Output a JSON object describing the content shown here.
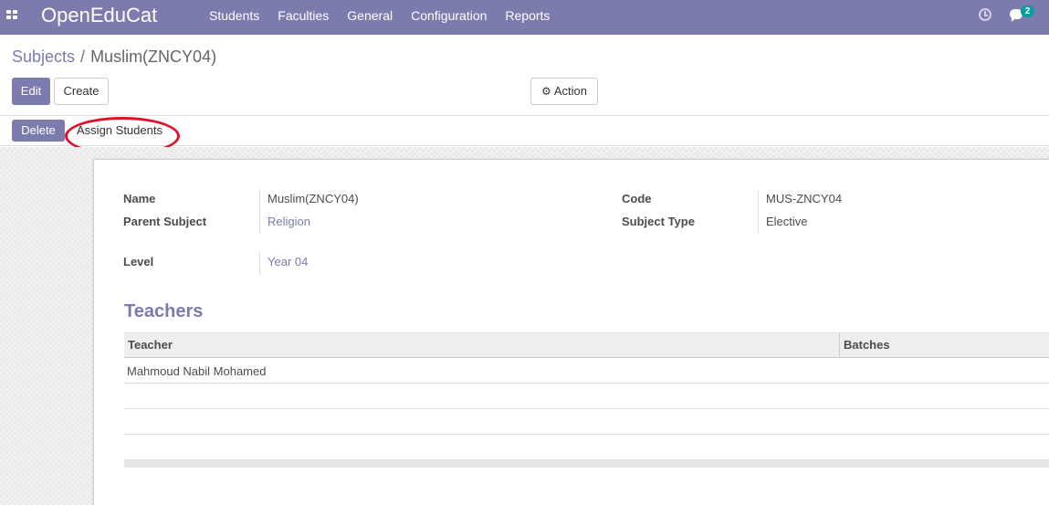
{
  "navbar": {
    "brand": "OpenEduCat",
    "menu": [
      "Students",
      "Faculties",
      "General",
      "Configuration",
      "Reports"
    ],
    "messages_count": "2"
  },
  "control_panel": {
    "breadcrumb": {
      "parent": "Subjects",
      "separator": "/",
      "current": "Muslim(ZNCY04)"
    },
    "edit_label": "Edit",
    "create_label": "Create",
    "action_label": "Action",
    "delete_label": "Delete",
    "assign_students_label": "Assign Students"
  },
  "form": {
    "name_label": "Name",
    "name_value": "Muslim(ZNCY04)",
    "parent_subject_label": "Parent Subject",
    "parent_subject_value": "Religion",
    "level_label": "Level",
    "level_value": "Year 04",
    "code_label": "Code",
    "code_value": "MUS-ZNCY04",
    "subject_type_label": "Subject Type",
    "subject_type_value": "Elective"
  },
  "teachers": {
    "title": "Teachers",
    "columns": [
      "Teacher",
      "Batches"
    ],
    "rows": [
      {
        "teacher": "Mahmoud Nabil Mohamed",
        "batches": ""
      }
    ]
  },
  "colors": {
    "brand": "#7c7bad",
    "highlight": "#e0102a",
    "badge": "#00a09d"
  }
}
